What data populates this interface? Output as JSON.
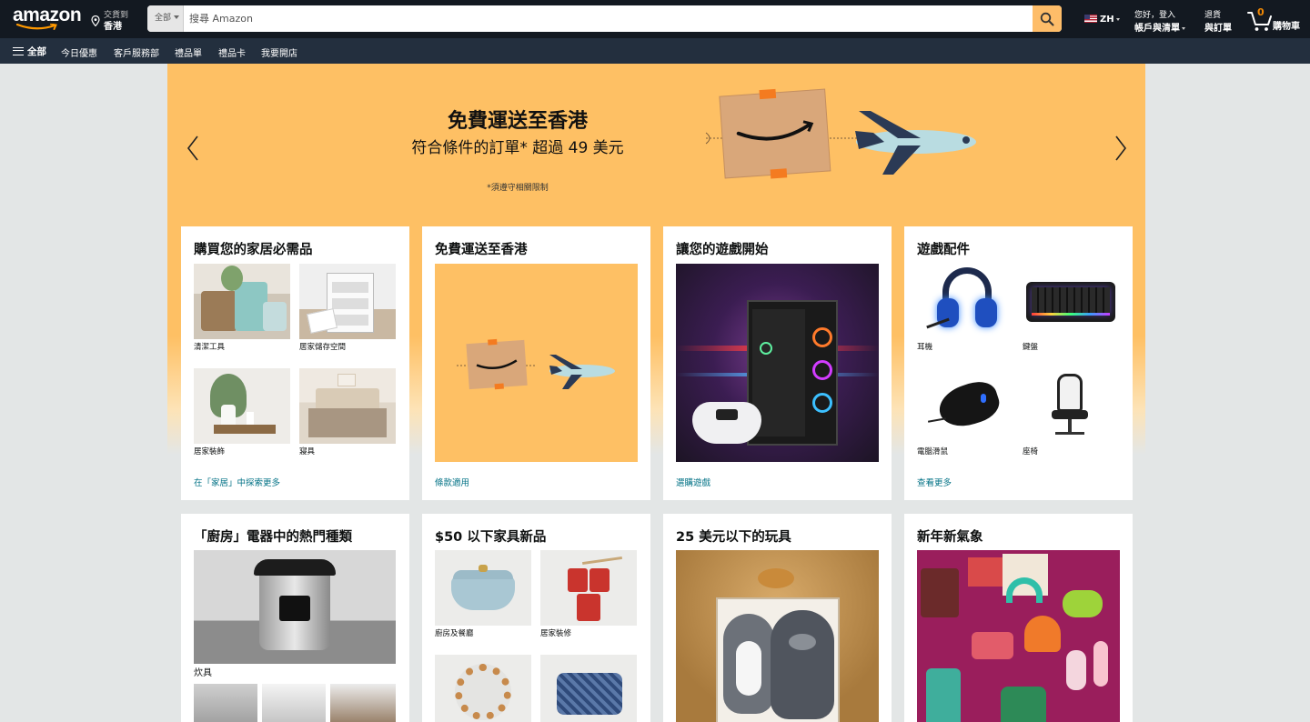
{
  "header": {
    "logo_text": "amazon",
    "deliver_to": "交貨到",
    "deliver_location": "香港",
    "search": {
      "department": "全部",
      "placeholder": "搜尋 Amazon"
    },
    "language": "ZH",
    "account_greeting": "您好，登入",
    "account_label": "帳戶與清單",
    "orders_line1": "退貨",
    "orders_line2": "與訂單",
    "cart_count": "0",
    "cart_label": "購物車"
  },
  "nav": {
    "all": "全部",
    "items": [
      "今日優惠",
      "客戶服務部",
      "禮品單",
      "禮品卡",
      "我要開店"
    ]
  },
  "hero": {
    "headline": "免費運送至香港",
    "subline": "符合條件的訂單* 超過 49 美元",
    "note": "*須遵守相關限制"
  },
  "cards": [
    {
      "title": "購買您的家居必需品",
      "items": [
        "清潔工具",
        "居家儲存空間",
        "居家裝飾",
        "寢具"
      ],
      "link": "在「家居」中探索更多"
    },
    {
      "title": "免費運送至香港",
      "link": "條款適用"
    },
    {
      "title": "讓您的遊戲開始",
      "link": "選購遊戲"
    },
    {
      "title": "遊戲配件",
      "items": [
        "耳機",
        "鍵盤",
        "電腦滑鼠",
        "座椅"
      ],
      "link": "查看更多"
    },
    {
      "title": "「廚房」電器中的熱門種類",
      "items": [
        "炊具"
      ]
    },
    {
      "title": "$50 以下家具新品",
      "items": [
        "廚房及餐廳",
        "居家裝修"
      ]
    },
    {
      "title": "25 美元以下的玩具"
    },
    {
      "title": "新年新氣象"
    }
  ],
  "colors": {
    "header_bg": "#131921",
    "subnav_bg": "#232f3e",
    "search_button": "#febd69",
    "hero_bg": "#fec064",
    "link": "#007185",
    "cart_count": "#f08804"
  }
}
